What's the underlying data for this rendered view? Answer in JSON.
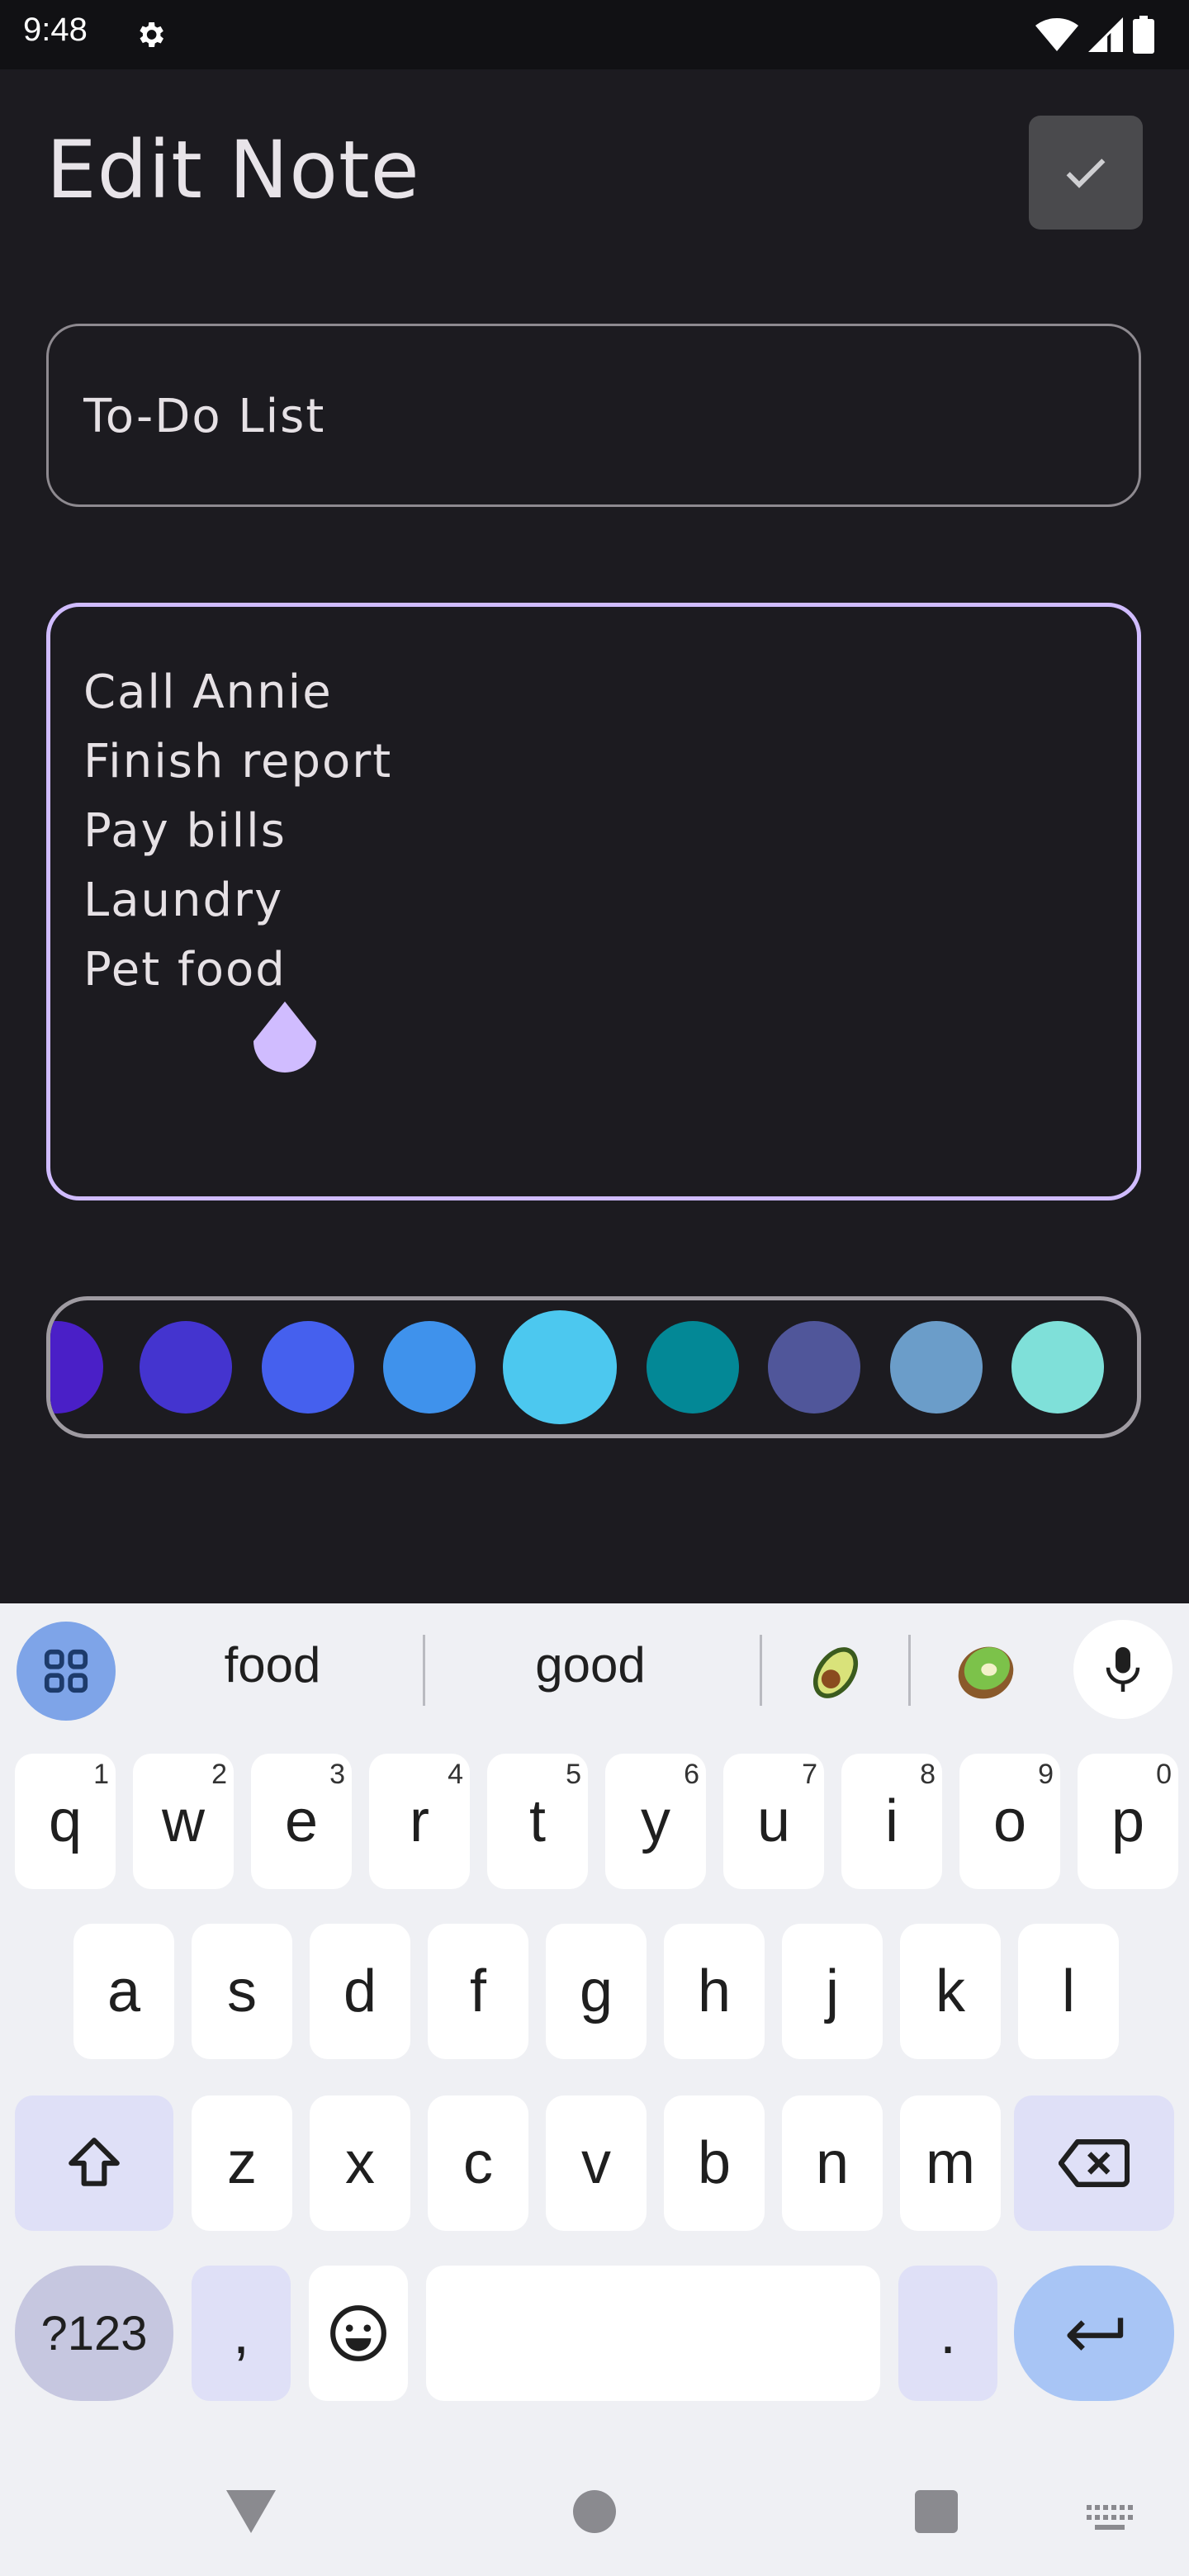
{
  "status": {
    "time": "9:48"
  },
  "header": {
    "title": "Edit Note"
  },
  "note": {
    "title_value": "To-Do List",
    "content_lines": [
      "Call Annie",
      "Finish report",
      "Pay bills",
      "Laundry",
      "Pet food"
    ]
  },
  "colors": {
    "swatches": [
      "#4a1fc7",
      "#4434cf",
      "#4560ee",
      "#3f92ec",
      "#4cc8ef",
      "#038896",
      "#50569a",
      "#6b9dc9",
      "#7fe0d9"
    ],
    "selected_index": 4,
    "accent": "#d0bcff"
  },
  "keyboard": {
    "suggestions": [
      "food",
      "good"
    ],
    "suggestion_emojis": [
      "avocado",
      "kiwi"
    ],
    "row1": [
      [
        "q",
        "1"
      ],
      [
        "w",
        "2"
      ],
      [
        "e",
        "3"
      ],
      [
        "r",
        "4"
      ],
      [
        "t",
        "5"
      ],
      [
        "y",
        "6"
      ],
      [
        "u",
        "7"
      ],
      [
        "i",
        "8"
      ],
      [
        "o",
        "9"
      ],
      [
        "p",
        "0"
      ]
    ],
    "row2": [
      "a",
      "s",
      "d",
      "f",
      "g",
      "h",
      "j",
      "k",
      "l"
    ],
    "row3": [
      "z",
      "x",
      "c",
      "v",
      "b",
      "n",
      "m"
    ],
    "symbols_label": "?123",
    "comma_label": ",",
    "period_label": "."
  }
}
